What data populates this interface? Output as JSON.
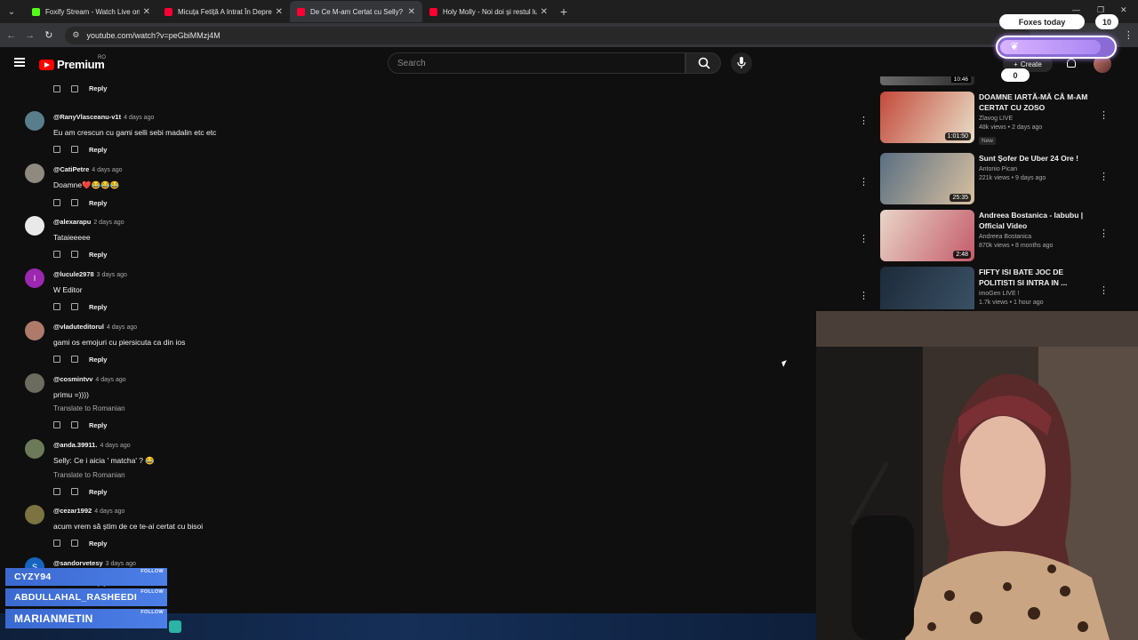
{
  "browser": {
    "tabs": [
      {
        "title": "Foxify Stream - Watch Live on Kick",
        "favicon_color": "#53fc18",
        "active": false
      },
      {
        "title": "Micuța Fetiță A Intrat În Depresie",
        "favicon_color": "#ff0033",
        "active": false
      },
      {
        "title": "De Ce M-am Certat cu Selly? - YouTube",
        "favicon_color": "#ff0033",
        "active": true
      },
      {
        "title": "Holy Molly - Noi doi și restul lumii",
        "favicon_color": "#ff0033",
        "active": false
      }
    ],
    "url": "youtube.com/watch?v=peGbiMMzj4M"
  },
  "header": {
    "logo_text": "Premium",
    "country_code": "RO",
    "search_placeholder": "Search",
    "create_label": "Create"
  },
  "comments": [
    {
      "author": "@RanyVlasceanu-v1t",
      "ago": "4 days ago",
      "text": "Eu am crescun cu gami selli sebi madalin etc etc",
      "translate": "",
      "avatar_color": "#5a7d8c",
      "letter": ""
    },
    {
      "author": "@CatiPetre",
      "ago": "4 days ago",
      "text": "Doamne❤️😂😂😂",
      "translate": "",
      "avatar_color": "#8e8a80",
      "letter": ""
    },
    {
      "author": "@alexarapu",
      "ago": "2 days ago",
      "text": "Tataieeeee",
      "translate": "",
      "avatar_color": "#e9e9e9",
      "letter": ""
    },
    {
      "author": "@lucule2978",
      "ago": "3 days ago",
      "text": "W Editor",
      "translate": "",
      "avatar_color": "#9c27b0",
      "letter": "l"
    },
    {
      "author": "@vladuteditorul",
      "ago": "4 days ago",
      "text": "gami os emojuri cu piersicuta ca din ios",
      "translate": "",
      "avatar_color": "#b07a6a",
      "letter": ""
    },
    {
      "author": "@cosmintvv",
      "ago": "4 days ago",
      "text": "primu =))))",
      "translate": "Translate to Romanian",
      "avatar_color": "#6b6b5e",
      "letter": ""
    },
    {
      "author": "@anda.39911.",
      "ago": "4 days ago",
      "text": "Selly: Ce i aicia ' matcha' ? 😂",
      "translate": "Translate to Romanian",
      "avatar_color": "#6d7a5a",
      "letter": ""
    },
    {
      "author": "@cezar1992",
      "ago": "4 days ago",
      "text": "acum vrem să știm de ce te-ai certat cu bisoi",
      "translate": "",
      "avatar_color": "#7c7340",
      "letter": ""
    },
    {
      "author": "@sandorvetesy",
      "ago": "3 days ago",
      "text": "",
      "translate": "",
      "avatar_color": "#1565c0",
      "letter": "S"
    }
  ],
  "reply_label": "Reply",
  "recommendations": [
    {
      "title": "DOAMNE IARTĂ-MĂ CĂ M-AM CERTAT CU ZOSO",
      "channel": "Zlavog LIVE",
      "views": "48k views",
      "ago": "2 days ago",
      "duration": "1:01:50",
      "badge": "New",
      "thumb_a": "#c34a3c",
      "thumb_b": "#e9dfc8"
    },
    {
      "title": "Sunt Șofer De Uber 24 Ore !",
      "channel": "Antonio Pican",
      "views": "221k views",
      "ago": "9 days ago",
      "duration": "25:35",
      "badge": "",
      "thumb_a": "#5a6f82",
      "thumb_b": "#d8c0a0"
    },
    {
      "title": "Andreea Bostanica - labubu | Official Video",
      "channel": "Andreea Bostanica",
      "views": "870k views",
      "ago": "8 months ago",
      "duration": "2:48",
      "badge": "",
      "thumb_a": "#e8d5c8",
      "thumb_b": "#c45b6a"
    },
    {
      "title": "FIFTY ISI BATE JOC DE POLITISTI SI INTRA IN ...",
      "channel": "imoGen LIVE !",
      "views": "1.7k views",
      "ago": "1 hour ago",
      "duration": "",
      "badge": "",
      "thumb_a": "#1d2a3a",
      "thumb_b": "#3b5266"
    }
  ],
  "top_rec_duration": "10:46",
  "overlay": {
    "goal_label": "Foxes today",
    "goal_count": "10",
    "bar_progress": 0.88,
    "counter": "0",
    "follows": [
      "CYZY94",
      "ABDULLAHAL_RASHEEDI",
      "MARIANMETIN"
    ],
    "follow_tag": "FOLLOW"
  }
}
